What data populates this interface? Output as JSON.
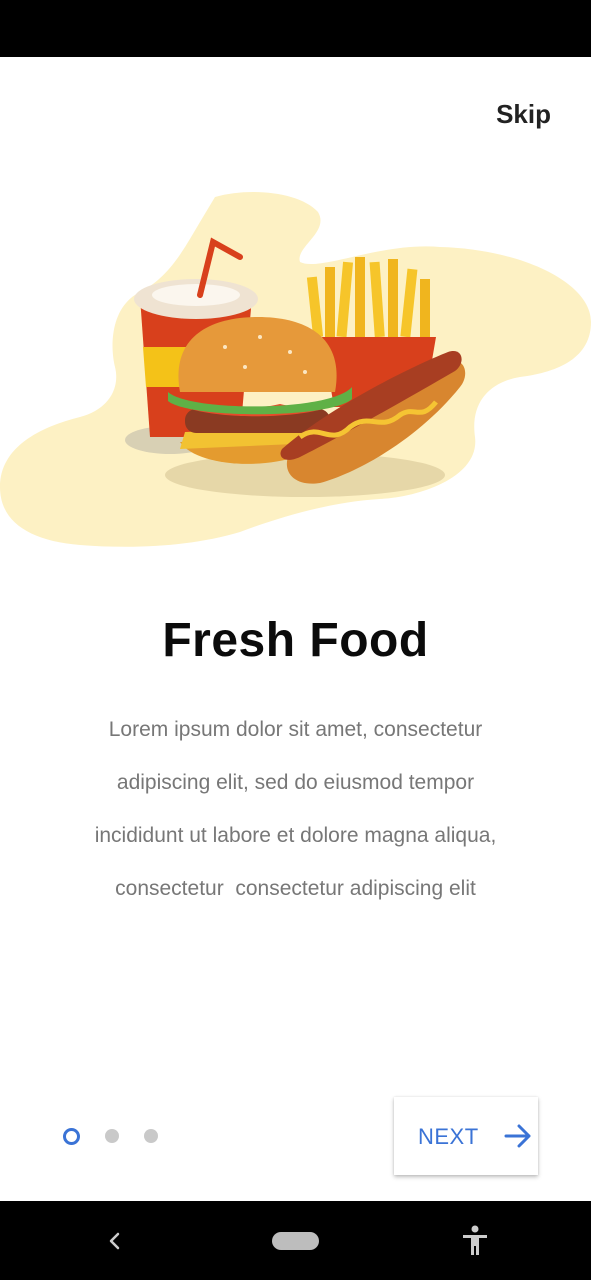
{
  "screen": {
    "skip_label": "Skip",
    "title": "Fresh Food",
    "body_lines": [
      "Lorem ipsum dolor sit amet, consectetur",
      "adipiscing elit, sed do eiusmod tempor",
      "incididunt ut labore et dolore magna aliqua,",
      "consectetur  consectetur adipiscing elit"
    ],
    "pager": {
      "total_pages": 3,
      "current_page": 1
    },
    "next_label": "NEXT",
    "next_icon": "arrow-right-icon",
    "illustration": "fast-food-illustration"
  },
  "colors": {
    "accent": "#3a73d6",
    "blob": "#fdf1c4",
    "title": "#0b0b0b",
    "body": "#777777"
  },
  "nav": {
    "back_icon": "back-chevron-icon",
    "home_icon": "home-pill-icon",
    "accessibility_icon": "accessibility-icon"
  }
}
